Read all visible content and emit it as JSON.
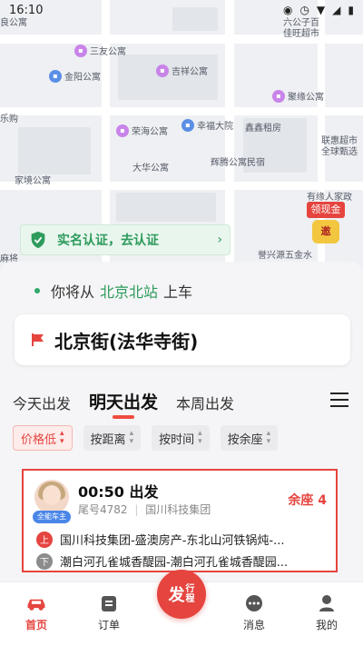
{
  "status": {
    "time": "16:10"
  },
  "map": {
    "pois": [
      {
        "name": "良公寓",
        "color": "purple"
      },
      {
        "name": "三友公寓",
        "color": "purple"
      },
      {
        "name": "金阳公寓",
        "color": "blue"
      },
      {
        "name": "吉祥公寓",
        "color": "purple"
      },
      {
        "name": "六公子百\n佳旺超市",
        "color": "blue"
      },
      {
        "name": "聚缘公寓",
        "color": "purple"
      },
      {
        "name": "乐购",
        "color": "purple"
      },
      {
        "name": "荣海公寓",
        "color": "purple"
      },
      {
        "name": "幸福大院",
        "color": "blue"
      },
      {
        "name": "鑫鑫租房",
        "color": "purple"
      },
      {
        "name": "联惠超市\n全球甄选",
        "color": "purple"
      },
      {
        "name": "大华公寓",
        "color": "purple"
      },
      {
        "name": "辉腾公寓民宿",
        "color": "purple"
      },
      {
        "name": "家境公寓",
        "color": "purple"
      },
      {
        "name": "有缘人家政",
        "color": "blue"
      },
      {
        "name": "麻将",
        "color": "purple"
      },
      {
        "name": "誉兴源五金水",
        "color": "blue"
      }
    ],
    "cash_badge": {
      "label": "领现金",
      "coin": "邀"
    }
  },
  "verify_banner": {
    "text": "实名认证，去认证",
    "arrow": "›"
  },
  "boarding": {
    "prefix": "你将从",
    "station": "北京北站",
    "suffix": "上车"
  },
  "destination": {
    "name": "北京街(法华寺街)"
  },
  "tabs": [
    {
      "label": "今天出发",
      "active": false
    },
    {
      "label": "明天出发",
      "active": true
    },
    {
      "label": "本周出发",
      "active": false
    }
  ],
  "sorts": [
    {
      "label": "价格低",
      "active": true
    },
    {
      "label": "按距离",
      "active": false
    },
    {
      "label": "按时间",
      "active": false
    },
    {
      "label": "按余座",
      "active": false
    }
  ],
  "trip": {
    "depart": "00:50 出发",
    "plate": "尾号4782",
    "company": "国川科技集团",
    "seats": "余座 4",
    "badge": "全能车主",
    "up_label": "上",
    "down_label": "下",
    "up_route": "国川科技集团-盛澳房产-东北山河铁锅炖-...",
    "down_route": "潮白河孔雀城香醍园-潮白河孔雀城香醍园..."
  },
  "nav": {
    "home": "首页",
    "orders": "订单",
    "fab_main": "发",
    "fab_sub1": "行",
    "fab_sub2": "程",
    "messages": "消息",
    "mine": "我的"
  },
  "colors": {
    "accent": "#e5443f",
    "green": "#2d9b5b"
  }
}
